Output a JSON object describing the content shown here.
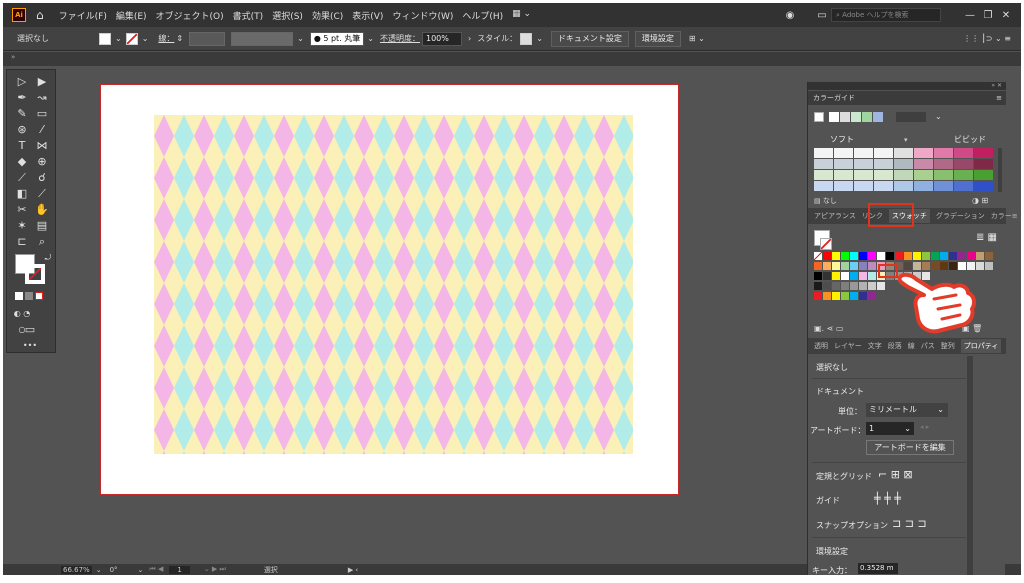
{
  "menubar": {
    "logo": "Ai",
    "items": [
      "ファイル(F)",
      "編集(E)",
      "オブジェクト(O)",
      "書式(T)",
      "選択(S)",
      "効果(C)",
      "表示(V)",
      "ウィンドウ(W)",
      "ヘルプ(H)"
    ],
    "workspace_icon": "workspace-switcher-icon",
    "help_search_placeholder": "Adobe ヘルプを検索"
  },
  "controlbar": {
    "selection_status": "選択なし",
    "stroke_label": "線：",
    "brush_label": "5 pt. 丸筆",
    "opacity_label": "不透明度：",
    "opacity_value": "100%",
    "style_label": "スタイル：",
    "doc_setup_button": "ドキュメント設定",
    "prefs_button": "環境設定"
  },
  "statusbar": {
    "zoom": "66.67%",
    "rotation": "0°",
    "artboard_number": "1",
    "tool_label": "選択"
  },
  "color_guide": {
    "title": "カラーガイド",
    "soft_label": "ソフト",
    "vivid_label": "ビビッド",
    "none_label": "なし"
  },
  "panel_tabs": {
    "items": [
      "アピアランス",
      "リンク",
      "スウォッチ",
      "グラデーション",
      "カラー"
    ],
    "active": "スウォッチ"
  },
  "properties_tabs": {
    "items": [
      "透明",
      "レイヤー",
      "文字",
      "段落",
      "線",
      "パス",
      "整列",
      "プロパティ"
    ]
  },
  "properties": {
    "no_selection": "選択なし",
    "document_header": "ドキュメント",
    "units_label": "単位：",
    "units_value": "ミリメートル",
    "artboard_label": "アートボード：",
    "artboard_value": "1",
    "edit_artboard_button": "アートボードを編集",
    "rulers_grid_label": "定規とグリッド",
    "guides_label": "ガイド",
    "snap_options_label": "スナップオプション",
    "prefs_header": "環境設定",
    "key_input_label": "キー入力：",
    "key_input_value": "0.3528 m"
  },
  "colors": {
    "highlight_box": "#e0341f",
    "pattern_bg": "#fbf1b8",
    "pattern_pink": "#f4b6e7",
    "pattern_cyan": "#b2ece8",
    "hand_outline": "#e23b2a"
  }
}
